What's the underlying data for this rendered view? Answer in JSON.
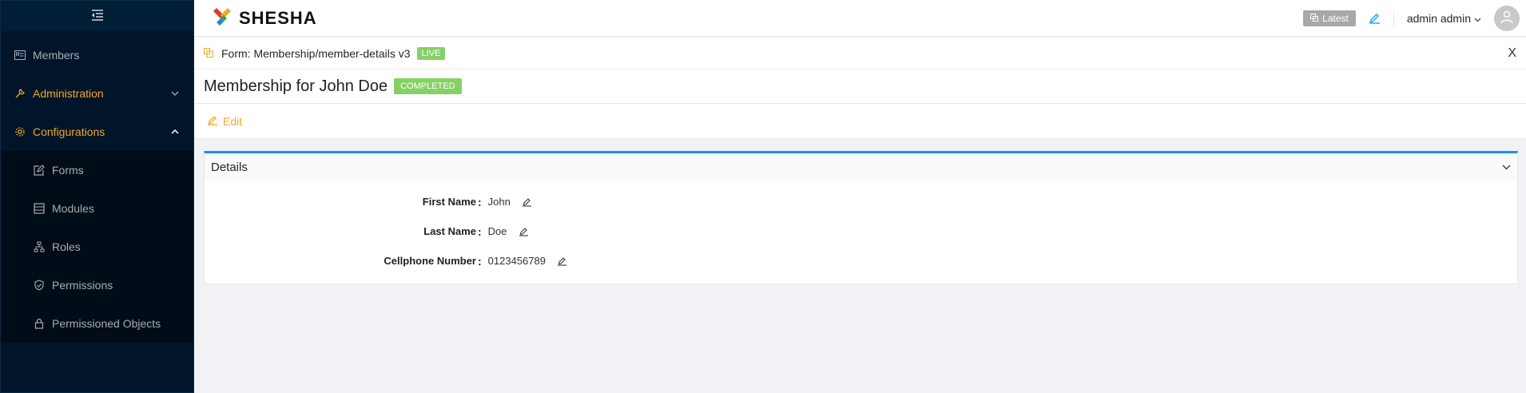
{
  "sidebar": {
    "items": [
      {
        "label": "Members",
        "icon": "id-card-icon"
      },
      {
        "label": "Administration",
        "icon": "tool-icon"
      },
      {
        "label": "Configurations",
        "icon": "gear-icon"
      }
    ],
    "sub_items": [
      {
        "label": "Forms",
        "icon": "form-edit-icon"
      },
      {
        "label": "Modules",
        "icon": "modules-icon"
      },
      {
        "label": "Roles",
        "icon": "hierarchy-icon"
      },
      {
        "label": "Permissions",
        "icon": "shield-icon"
      },
      {
        "label": "Permissioned Objects",
        "icon": "lock-icon"
      }
    ]
  },
  "header": {
    "logo_text": "SHESHA",
    "latest_label": "Latest",
    "user_name": "admin admin"
  },
  "form_bar": {
    "text": "Form: Membership/member-details v3",
    "live_label": "LIVE",
    "close_label": "X"
  },
  "title": {
    "text": "Membership for John Doe",
    "status": "COMPLETED"
  },
  "toolbar": {
    "edit_label": "Edit"
  },
  "panel": {
    "title": "Details",
    "fields": [
      {
        "label": "First Name",
        "value": "John"
      },
      {
        "label": "Last Name",
        "value": "Doe"
      },
      {
        "label": "Cellphone Number",
        "value": "0123456789"
      }
    ]
  },
  "colors": {
    "sidebar_bg": "#001529",
    "accent": "#f5a623",
    "primary": "#1890ff",
    "success": "#87d068"
  }
}
